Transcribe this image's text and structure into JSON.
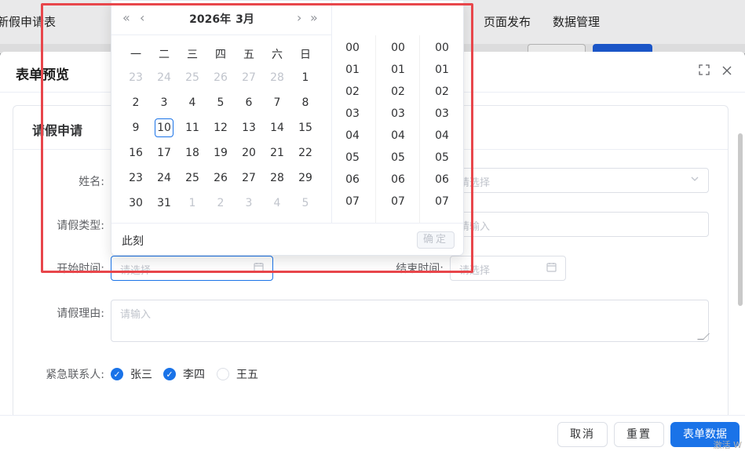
{
  "background": {
    "nav_items": [
      "新假申请表",
      "页面发布",
      "数据管理"
    ]
  },
  "modal": {
    "title": "表单预览",
    "fullscreen_icon": "fullscreen-icon",
    "close_icon": "close-icon",
    "card_title": "请假申请",
    "fields": {
      "name": {
        "label": "姓名:"
      },
      "dept": {
        "placeholder": "请选择"
      },
      "leave_type": {
        "label": "请假类型:"
      },
      "days": {
        "placeholder": "请输入"
      },
      "start_time": {
        "label": "开始时间:",
        "placeholder": "请选择"
      },
      "end_time": {
        "label": "结束时间:",
        "placeholder": "请选择"
      },
      "reason": {
        "label": "请假理由:",
        "placeholder": "请输入"
      },
      "contacts": {
        "label": "紧急联系人:",
        "options": [
          {
            "label": "张三",
            "checked": true
          },
          {
            "label": "李四",
            "checked": true
          },
          {
            "label": "王五",
            "checked": false
          }
        ]
      }
    },
    "footer": {
      "cancel": "取消",
      "reset": "重置",
      "submit": "表单数据",
      "watermark": "激活 W"
    }
  },
  "picker": {
    "year": "2026年",
    "month": "3月",
    "weekdays": [
      "一",
      "二",
      "三",
      "四",
      "五",
      "六",
      "日"
    ],
    "weeks": [
      [
        [
          "23",
          0
        ],
        [
          "24",
          0
        ],
        [
          "25",
          0
        ],
        [
          "26",
          0
        ],
        [
          "27",
          0
        ],
        [
          "28",
          0
        ],
        [
          "1",
          1
        ]
      ],
      [
        [
          "2",
          1
        ],
        [
          "3",
          1
        ],
        [
          "4",
          1
        ],
        [
          "5",
          1
        ],
        [
          "6",
          1
        ],
        [
          "7",
          1
        ],
        [
          "8",
          1
        ]
      ],
      [
        [
          "9",
          1
        ],
        [
          "10",
          1
        ],
        [
          "11",
          1
        ],
        [
          "12",
          1
        ],
        [
          "13",
          1
        ],
        [
          "14",
          1
        ],
        [
          "15",
          1
        ]
      ],
      [
        [
          "16",
          1
        ],
        [
          "17",
          1
        ],
        [
          "18",
          1
        ],
        [
          "19",
          1
        ],
        [
          "20",
          1
        ],
        [
          "21",
          1
        ],
        [
          "22",
          1
        ]
      ],
      [
        [
          "23",
          1
        ],
        [
          "24",
          1
        ],
        [
          "25",
          1
        ],
        [
          "26",
          1
        ],
        [
          "27",
          1
        ],
        [
          "28",
          1
        ],
        [
          "29",
          1
        ]
      ],
      [
        [
          "30",
          1
        ],
        [
          "31",
          1
        ],
        [
          "1",
          0
        ],
        [
          "2",
          0
        ],
        [
          "3",
          0
        ],
        [
          "4",
          0
        ],
        [
          "5",
          0
        ]
      ]
    ],
    "today": "10",
    "hours": [
      "00",
      "01",
      "02",
      "03",
      "04",
      "05",
      "06",
      "07"
    ],
    "minutes": [
      "00",
      "01",
      "02",
      "03",
      "04",
      "05",
      "06",
      "07"
    ],
    "seconds": [
      "00",
      "01",
      "02",
      "03",
      "04",
      "05",
      "06",
      "07"
    ],
    "now_label": "此刻",
    "ok_label": "确定"
  },
  "colors": {
    "primary": "#1a73e8",
    "highlight": "#e8464b"
  }
}
